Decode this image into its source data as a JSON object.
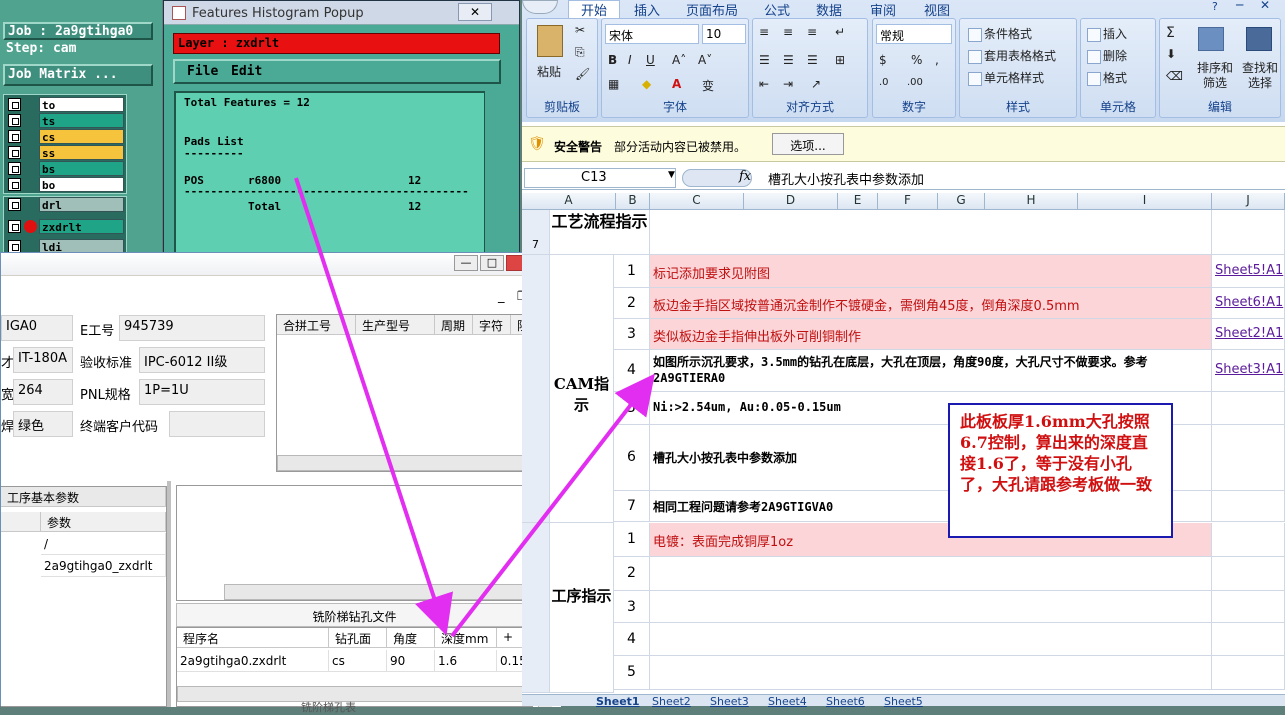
{
  "genesis": {
    "job": "Job : 2a9gtihga0",
    "step": "Step: cam",
    "job_matrix": "Job Matrix ...",
    "layers": [
      {
        "name": "to",
        "color": "#ffffff"
      },
      {
        "name": "ts",
        "color": "#1fa488"
      },
      {
        "name": "cs",
        "color": "#f6c33c"
      },
      {
        "name": "ss",
        "color": "#f6c33c"
      },
      {
        "name": "bs",
        "color": "#1fa488"
      },
      {
        "name": "bo",
        "color": "#ffffff"
      },
      {
        "name": "drl",
        "color": "#9fbfb8"
      },
      {
        "name": "zxdrlt",
        "color": "#1fa488"
      },
      {
        "name": "ldi",
        "color": "#9fbfb8"
      }
    ]
  },
  "features_popup": {
    "title": "Features Histogram Popup",
    "layer": "Layer :  zxdrlt",
    "menu_file": "File",
    "menu_edit": "Edit",
    "total_features": "Total Features = 12",
    "pads_list": "Pads List",
    "pads_underline": "---------",
    "pos": "POS",
    "symbol": "r6800",
    "count": "12",
    "separator": "-------------------------------------------",
    "total_label": "Total",
    "total_count": "12"
  },
  "erp": {
    "fields": [
      {
        "label": "",
        "value": "IGA0"
      },
      {
        "label": "E工号",
        "value": "945739"
      },
      {
        "label": "才",
        "value": "IT-180A"
      },
      {
        "label": "验收标准",
        "value": "IPC-6012 II级"
      },
      {
        "label": "宽",
        "value": "264"
      },
      {
        "label": "PNL规格",
        "value": "1P=1U"
      },
      {
        "label": "焊",
        "value": "绿色"
      },
      {
        "label": "终端客户代码",
        "value": ""
      }
    ],
    "merge_columns": [
      "合拼工号",
      "生产型号",
      "周期",
      "字符",
      "阻焊"
    ],
    "process_tab": "工序基本参数",
    "param_header": "参数",
    "params": [
      "/",
      "2a9gtihga0_zxdrlt"
    ],
    "step_drill_title": "铣阶梯钻孔文件",
    "drill_columns": [
      "程序名",
      "钻孔面",
      "角度",
      "深度mm",
      "+"
    ],
    "drill_row": [
      "2a9gtihga0.zxdrlt",
      "cs",
      "90",
      "1.6",
      "0.15"
    ],
    "bottom_label": "铣阶梯孔表"
  },
  "excel": {
    "tabs": [
      "开始",
      "插入",
      "页面布局",
      "公式",
      "数据",
      "审阅",
      "视图"
    ],
    "font_name": "宋体",
    "font_size": "10",
    "number_format": "常规",
    "groups": [
      "剪贴板",
      "字体",
      "对齐方式",
      "数字",
      "样式",
      "单元格",
      "编辑"
    ],
    "paste": "粘贴",
    "style_buttons": [
      "条件格式",
      "套用表格格式",
      "单元格样式"
    ],
    "cell_buttons": [
      "插入",
      "删除",
      "格式"
    ],
    "edit_buttons": [
      "排序和筛选",
      "查找和选择"
    ],
    "security_label": "安全警告",
    "security_text": "部分活动内容已被禁用。",
    "options_button": "选项...",
    "name_box": "C13",
    "fx": "fx",
    "formula": "槽孔大小按孔表中参数添加",
    "columns": [
      "A",
      "B",
      "C",
      "D",
      "E",
      "F",
      "G",
      "H",
      "I",
      "J"
    ],
    "row7_num": "7",
    "section1": "工艺流程指示",
    "section2": "CAM指示",
    "section3": "工序指示",
    "cam_rows": [
      {
        "n": "1",
        "text": "标记添加要求见附图",
        "link": "Sheet5!A1",
        "pink": true
      },
      {
        "n": "2",
        "text": "板边金手指区域按普通沉金制作不镀硬金，需倒角45度，倒角深度0.5mm",
        "link": "Sheet6!A1",
        "pink": true
      },
      {
        "n": "3",
        "text": "类似板边金手指伸出板外可削铜制作",
        "link": "Sheet2!A1",
        "pink": true
      },
      {
        "n": "4",
        "text": "如图所示沉孔要求，3.5mm的钻孔在底层，大孔在顶层，角度90度，大孔尺寸不做要求。参考2A9GTIERA0",
        "link": "Sheet3!A1",
        "pink": false
      },
      {
        "n": "5",
        "text": "Ni:>2.54um, Au:0.05-0.15um",
        "link": "",
        "pink": false
      },
      {
        "n": "6",
        "text": "槽孔大小按孔表中参数添加",
        "link": "",
        "pink": false
      },
      {
        "n": "7",
        "text": "相同工程问题请参考2A9GTIGVA0",
        "link": "",
        "pink": false
      }
    ],
    "proc_rows": [
      {
        "n": "1",
        "text": "电镀：表面完成铜厚1oz"
      },
      {
        "n": "2",
        "text": ""
      },
      {
        "n": "3",
        "text": ""
      },
      {
        "n": "4",
        "text": ""
      },
      {
        "n": "5",
        "text": ""
      }
    ],
    "note": "此板板厚1.6mm大孔按照6.7控制，算出来的深度直接1.6了，等于没有小孔了，大孔请跟参考板做一致",
    "sheet_tabs": [
      "Sheet1",
      "Sheet2",
      "Sheet3",
      "Sheet4",
      "Sheet6",
      "Sheet5"
    ]
  },
  "colors": {
    "arrow": "#e22ef0",
    "pink_row": "#fbd5d8",
    "note_border": "#1a1ab0",
    "note_text": "#d01010",
    "genesis_bg": "#4fa38f"
  }
}
